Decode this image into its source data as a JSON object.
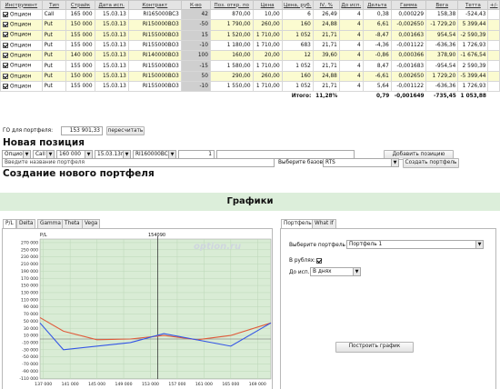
{
  "table": {
    "headers": [
      "Инструмент",
      "Тип",
      "Страйк",
      "Дата исп.",
      "Контракт",
      "К-во",
      "Поз. откр. по",
      "Цена",
      "Цена, руб.",
      "IV, %",
      "До исп.",
      "Дельта",
      "Гамма",
      "Вега",
      "Тетта",
      "+/-"
    ],
    "rows": [
      [
        "Опцион",
        "Call",
        "165 000",
        "15.03.13",
        "RI165000BC3",
        "42",
        "870,00",
        "10,00",
        "6",
        "26,49",
        "4",
        "0,38",
        "0,000229",
        "158,38",
        "-524,43"
      ],
      [
        "Опцион",
        "Put",
        "150 000",
        "15.03.13",
        "RI150000BO3",
        "-50",
        "1 790,00",
        "260,00",
        "160",
        "24,88",
        "4",
        "6,61",
        "-0,002650",
        "-1 729,20",
        "5 399,44"
      ],
      [
        "Опцион",
        "Put",
        "155 000",
        "15.03.13",
        "RI155000BO3",
        "15",
        "1 520,00",
        "1 710,00",
        "1 052",
        "21,71",
        "4",
        "-8,47",
        "0,001663",
        "954,54",
        "-2 590,39"
      ],
      [
        "Опцион",
        "Put",
        "155 000",
        "15.03.13",
        "RI155000BO3",
        "-10",
        "1 180,00",
        "1 710,00",
        "683",
        "21,71",
        "4",
        "-4,36",
        "-0,001122",
        "-636,36",
        "1 726,93"
      ],
      [
        "Опцион",
        "Put",
        "140 000",
        "15.03.13",
        "RI140000BO3",
        "100",
        "160,00",
        "20,00",
        "12",
        "39,60",
        "4",
        "-0,86",
        "0,000366",
        "378,90",
        "-1 676,54"
      ],
      [
        "Опцион",
        "Put",
        "155 000",
        "15.03.13",
        "RI155000BO3",
        "-15",
        "1 580,00",
        "1 710,00",
        "1 052",
        "21,71",
        "4",
        "8,47",
        "-0,001683",
        "-954,54",
        "2 590,39"
      ],
      [
        "Опцион",
        "Put",
        "150 000",
        "15.03.13",
        "RI150000BO3",
        "50",
        "290,00",
        "260,00",
        "160",
        "24,88",
        "4",
        "-6,61",
        "0,002650",
        "1 729,20",
        "-5 399,44"
      ],
      [
        "Опцион",
        "Put",
        "155 000",
        "15.03.13",
        "RI155000BO3",
        "-10",
        "1 550,00",
        "1 710,00",
        "1 052",
        "21,71",
        "4",
        "5,64",
        "-0,001122",
        "-636,36",
        "1 726,93"
      ]
    ],
    "total_label": "Итого:",
    "total_iv": "11,28%",
    "total_delta": "0,79",
    "total_gamma": "-0,001649",
    "total_vega": "-735,45",
    "total_theta": "1 053,88"
  },
  "go": {
    "label": "ГО для портфеля:",
    "value": "153 901,33",
    "button": "пересчитать"
  },
  "new_position": {
    "title": "Новая позиция",
    "instrument": "Опцион",
    "type": "Call",
    "strike": "160 000",
    "date": "15.03.13г",
    "contract": "RI160000BC3",
    "qty": "1",
    "button": "Добавить позицию"
  },
  "create_portfolio": {
    "title": "Создание нового портфеля",
    "name_placeholder": "Введите название портфеля",
    "asset_label": "Выберите базовый актив",
    "asset": "RTS",
    "button": "Создать портфель"
  },
  "charts": {
    "title": "Графики",
    "tabs": [
      "P/L",
      "Delta",
      "Gamma",
      "Theta",
      "Vega"
    ],
    "watermark": "option.ru",
    "cursor_label": "154090"
  },
  "settings": {
    "tabs": [
      "Портфель",
      "What if"
    ],
    "portfolio_label": "Выберите портфель",
    "portfolio": "Портфель 1",
    "rub_label": "В рублях:",
    "exp_label": "До исп.:",
    "exp_value": "В днях",
    "button": "Построить график"
  },
  "colors": {
    "green": "#d9ecd5",
    "red_line": "#e05a3a",
    "blue_line": "#3355e6",
    "header_bar": "#dceeda"
  },
  "chart_data": {
    "type": "line",
    "title": "",
    "ylabel": "P/L",
    "cursor_x": 154090,
    "xlim": [
      136500,
      171000
    ],
    "ylim": [
      -112000,
      280000
    ],
    "x_ticks": [
      137000,
      141000,
      145000,
      149000,
      153000,
      157000,
      161000,
      165000,
      169000
    ],
    "x_tick_labels": [
      "137 000",
      "141 000",
      "145 000",
      "149 000",
      "153 000",
      "157 000",
      "161 000",
      "165 000",
      "169 000"
    ],
    "y_ticks": [
      270000,
      250000,
      230000,
      210000,
      190000,
      170000,
      150000,
      130000,
      110000,
      90000,
      70000,
      50000,
      30000,
      10000,
      -10000,
      -30000,
      -50000,
      -70000,
      -90000,
      -110000
    ],
    "y_tick_labels": [
      "270 000",
      "250 000",
      "230 000",
      "210 000",
      "190 000",
      "170 000",
      "150 000",
      "130 000",
      "110 000",
      "90 000",
      "70 000",
      "50 000",
      "30 000",
      "10 000",
      "-10 000",
      "-30 000",
      "-50 000",
      "-70 000",
      "-90 000",
      "-110 000"
    ],
    "series": [
      {
        "x": [
          136500,
          140000,
          145000,
          150000,
          155000,
          160000,
          165000,
          171000
        ],
        "values": [
          60000,
          22000,
          -2000,
          0,
          10000,
          -2000,
          10000,
          45000
        ]
      },
      {
        "x": [
          136500,
          140000,
          150000,
          155000,
          165000,
          171000
        ],
        "values": [
          45000,
          -30000,
          -10000,
          15000,
          -20000,
          45000
        ]
      }
    ]
  }
}
